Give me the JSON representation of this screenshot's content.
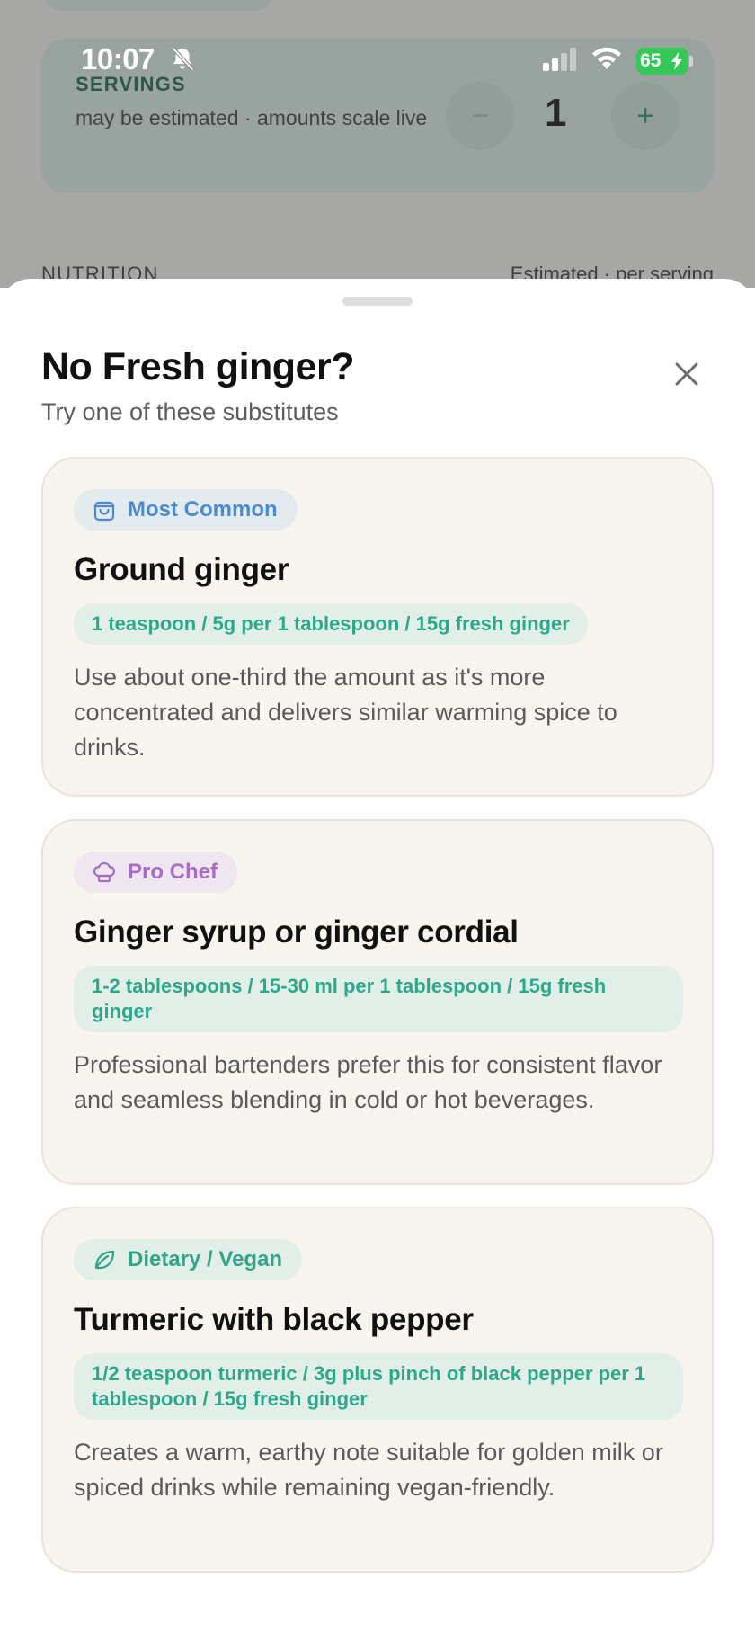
{
  "status_bar": {
    "time": "10:07",
    "battery_level": "65",
    "icons": [
      "bell-slash-icon",
      "cellular-signal-icon",
      "wifi-icon",
      "battery-charging-icon"
    ]
  },
  "background_page": {
    "servings": {
      "title": "SERVINGS",
      "note": "may be estimated · amounts scale live",
      "value": "1",
      "decrement_label": "−",
      "increment_label": "+"
    },
    "nutrition": {
      "label": "NUTRITION",
      "note": "Estimated · per serving"
    }
  },
  "sheet": {
    "title": "No Fresh ginger?",
    "subtitle": "Try one of these substitutes",
    "close_icon": "close-icon",
    "substitutes": [
      {
        "tag": "Most Common",
        "tag_icon": "shopping-bag-icon",
        "tag_color": "#4a8ccc",
        "name": "Ground ginger",
        "amount": "1 teaspoon / 5g per 1 tablespoon / 15g fresh ginger",
        "description": "Use about one-third the amount as it's more concentrated and delivers similar warming spice to drinks."
      },
      {
        "tag": "Pro Chef",
        "tag_icon": "chef-hat-icon",
        "tag_color": "#a56cc8",
        "name": "Ginger syrup or ginger cordial",
        "amount": "1-2 tablespoons / 15-30 ml per 1 tablespoon / 15g fresh ginger",
        "description": "Professional bartenders prefer this for consistent flavor and seamless blending in cold or hot beverages."
      },
      {
        "tag": "Dietary / Vegan",
        "tag_icon": "leaf-icon",
        "tag_color": "#32a48a",
        "name": "Turmeric with black pepper",
        "amount": "1/2 teaspoon turmeric / 3g plus pinch of black pepper per 1 tablespoon / 15g fresh ginger",
        "description": "Creates a warm, earthy note suitable for golden milk or spiced drinks while remaining vegan-friendly."
      }
    ]
  },
  "colors": {
    "accent_green": "#2da88b",
    "servings_card_bg": "#dcefe8",
    "card_bg": "#f8f5ef",
    "amount_pill_bg": "#e2efe8"
  }
}
